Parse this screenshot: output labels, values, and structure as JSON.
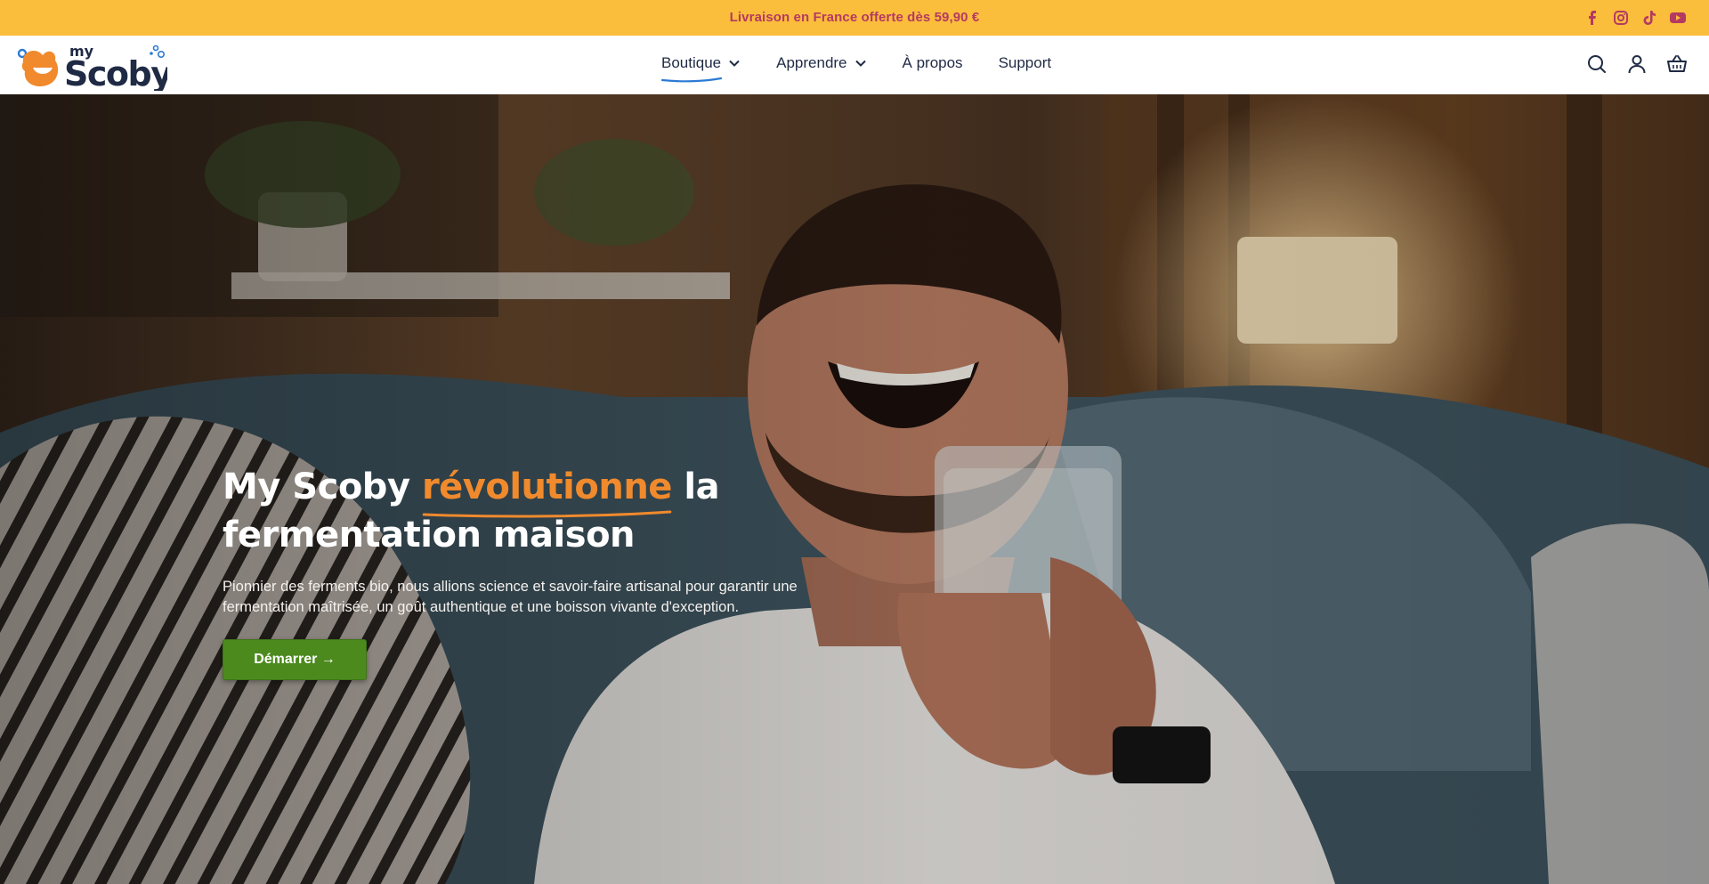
{
  "announcement": {
    "text": "Livraison en France offerte dès 59,90 €"
  },
  "socials": [
    {
      "icon": "facebook-icon"
    },
    {
      "icon": "instagram-icon"
    },
    {
      "icon": "tiktok-icon"
    },
    {
      "icon": "youtube-icon"
    }
  ],
  "brand": {
    "logo_small": "my",
    "logo_main": "Scoby"
  },
  "nav": {
    "items": [
      {
        "label": "Boutique"
      },
      {
        "label": "Apprendre"
      },
      {
        "label": "À propos"
      },
      {
        "label": "Support"
      }
    ]
  },
  "header_icons": [
    "search-icon",
    "account-icon",
    "basket-icon"
  ],
  "hero": {
    "title_before": "My Scoby ",
    "title_highlight": "révolutionne",
    "title_after": " la fermentation maison",
    "subtitle": "Pionnier des ferments bio, nous allions science et savoir-faire artisanal pour garantir une fermentation maîtrisée, un goût authentique et une boisson vivante d'exception.",
    "cta_label": "Démarrer →"
  },
  "colors": {
    "announce_bg": "#fbbd3c",
    "announce_text": "#b43a62",
    "accent_orange": "#f08a2d",
    "cta_green": "#4c8a1e",
    "nav_text": "#1f2a44",
    "underline_blue": "#2b7bd3"
  }
}
